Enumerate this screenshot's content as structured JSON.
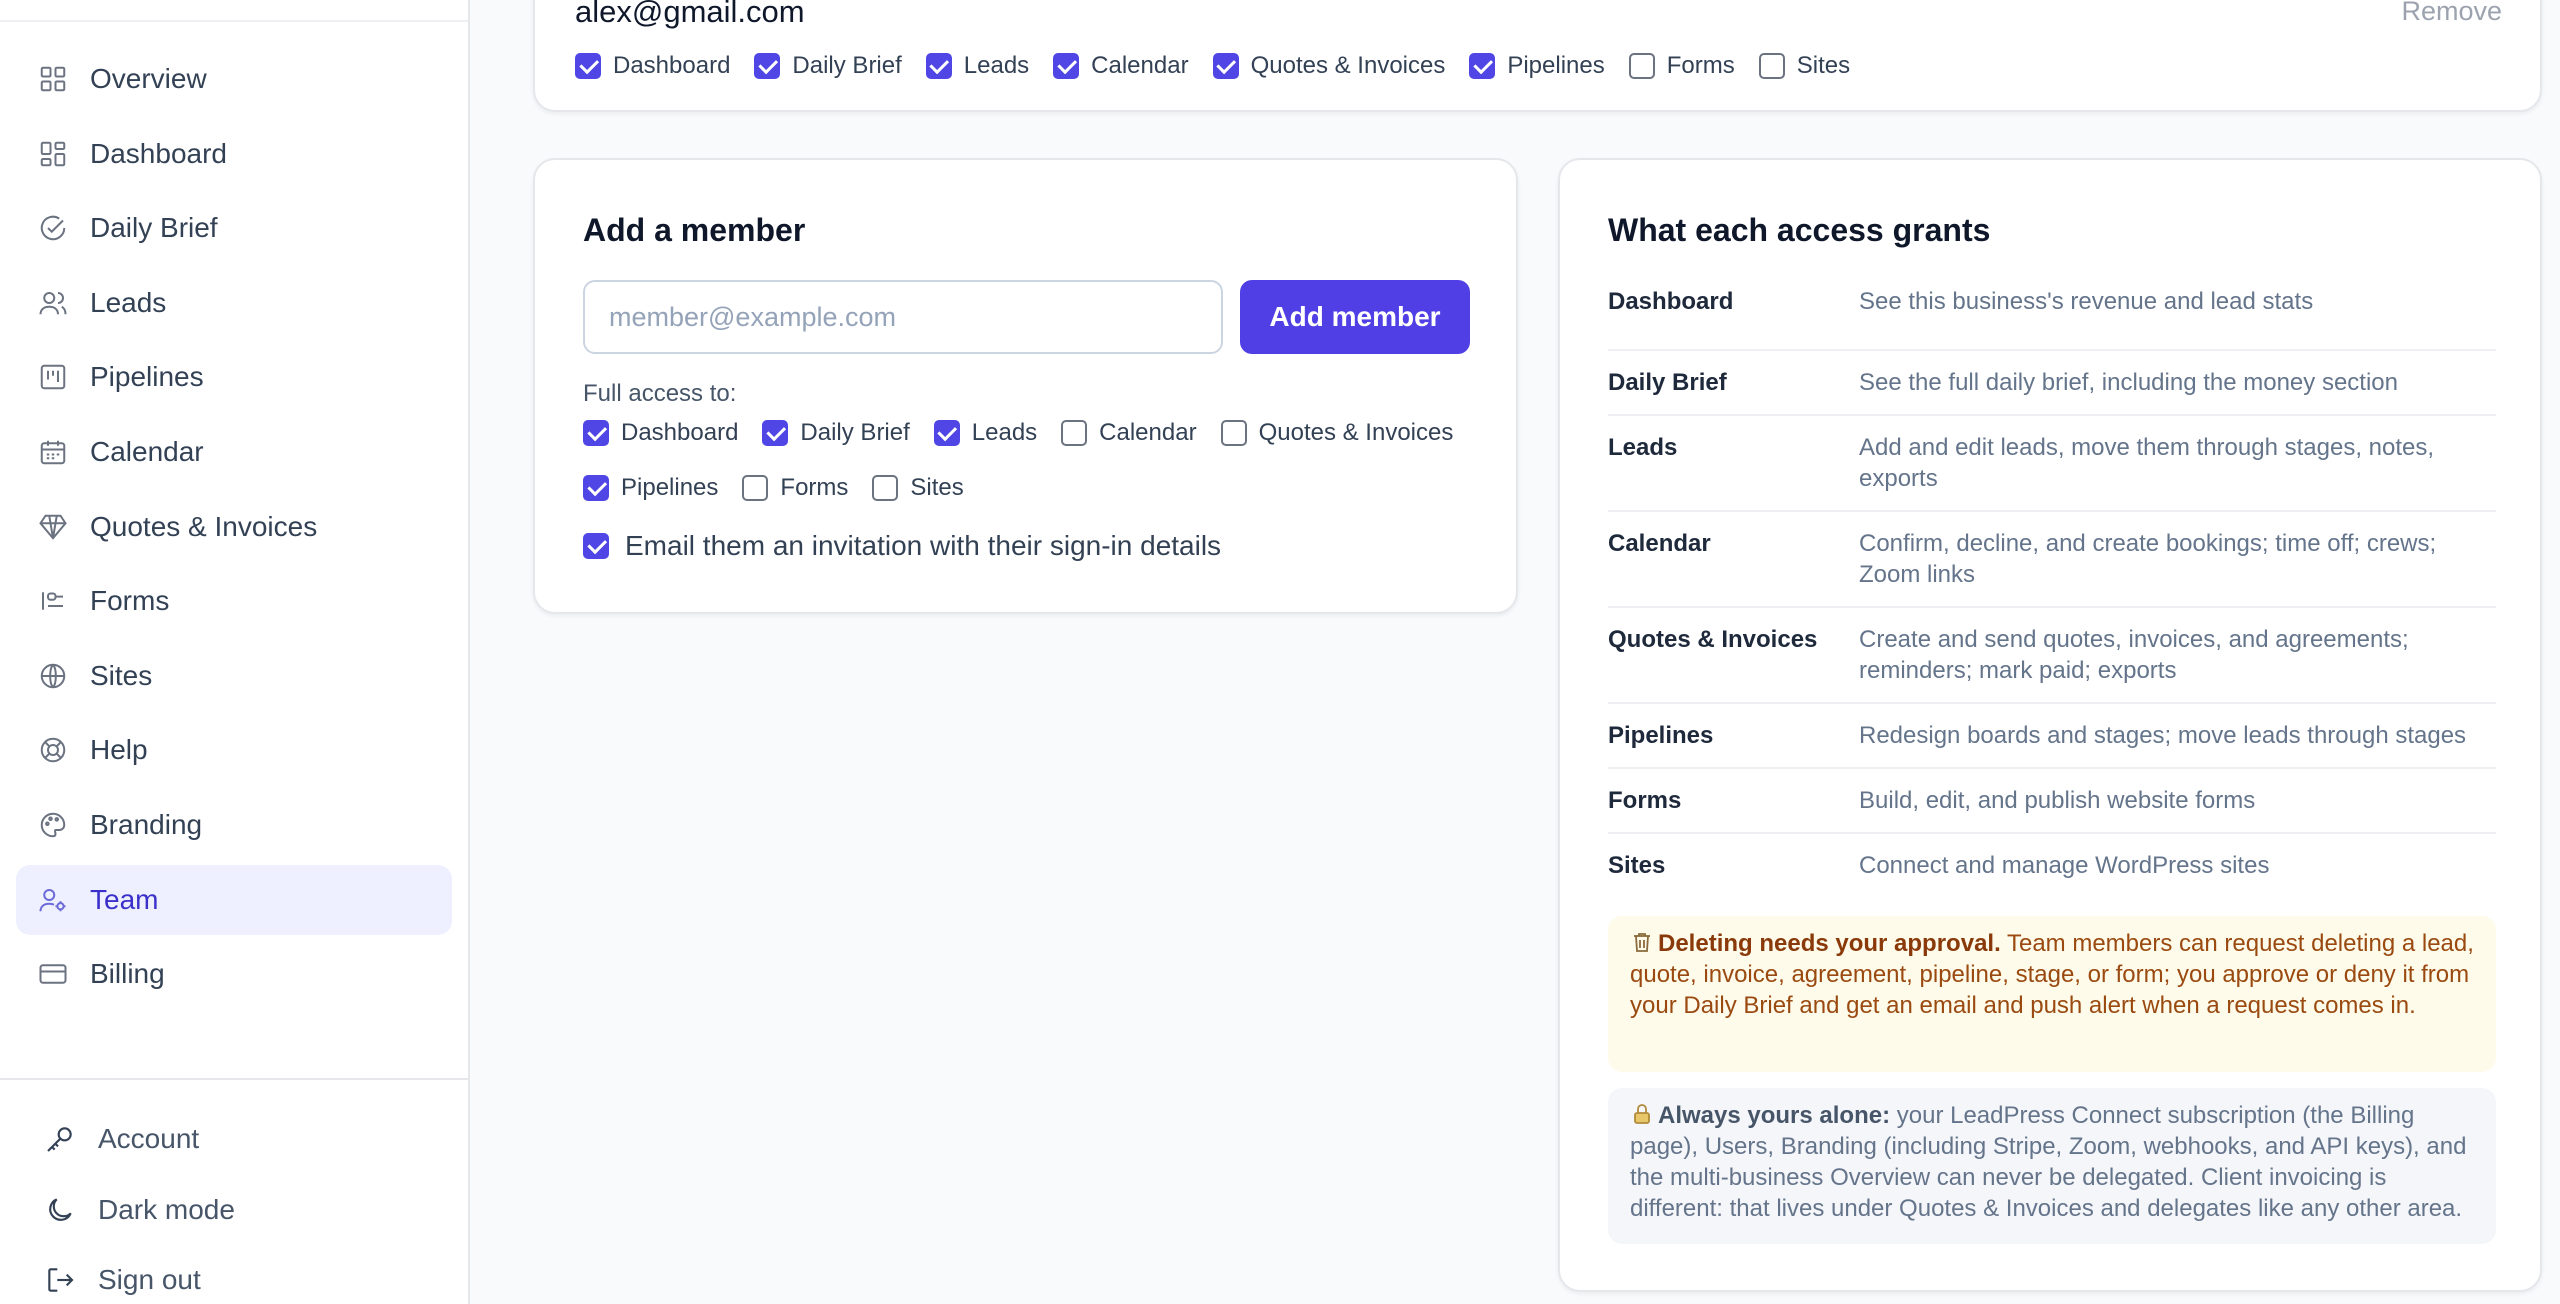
{
  "sidebar": {
    "items": [
      {
        "label": "Overview",
        "icon": "grid-icon"
      },
      {
        "label": "Dashboard",
        "icon": "dashboard-icon"
      },
      {
        "label": "Daily Brief",
        "icon": "check-circle-icon"
      },
      {
        "label": "Leads",
        "icon": "users-icon"
      },
      {
        "label": "Pipelines",
        "icon": "kanban-icon"
      },
      {
        "label": "Calendar",
        "icon": "calendar-icon"
      },
      {
        "label": "Quotes & Invoices",
        "icon": "diamond-icon"
      },
      {
        "label": "Forms",
        "icon": "form-icon"
      },
      {
        "label": "Sites",
        "icon": "globe-icon"
      },
      {
        "label": "Help",
        "icon": "lifebuoy-icon"
      },
      {
        "label": "Branding",
        "icon": "palette-icon"
      },
      {
        "label": "Team",
        "icon": "user-gear-icon",
        "active": true
      },
      {
        "label": "Billing",
        "icon": "credit-card-icon"
      }
    ],
    "bottom": [
      {
        "label": "Account",
        "icon": "key-icon"
      },
      {
        "label": "Dark mode",
        "icon": "moon-icon"
      },
      {
        "label": "Sign out",
        "icon": "sign-out-icon"
      }
    ]
  },
  "existing_member": {
    "email": "alex@gmail.com",
    "remove_label": "Remove",
    "permissions": [
      {
        "label": "Dashboard",
        "checked": true
      },
      {
        "label": "Daily Brief",
        "checked": true
      },
      {
        "label": "Leads",
        "checked": true
      },
      {
        "label": "Calendar",
        "checked": true
      },
      {
        "label": "Quotes & Invoices",
        "checked": true
      },
      {
        "label": "Pipelines",
        "checked": true
      },
      {
        "label": "Forms",
        "checked": false
      },
      {
        "label": "Sites",
        "checked": false
      }
    ]
  },
  "add_member": {
    "title": "Add a member",
    "email_placeholder": "member@example.com",
    "email_value": "",
    "button_label": "Add member",
    "full_access_label": "Full access to:",
    "permissions_row1": [
      {
        "label": "Dashboard",
        "checked": true
      },
      {
        "label": "Daily Brief",
        "checked": true
      },
      {
        "label": "Leads",
        "checked": true
      },
      {
        "label": "Calendar",
        "checked": false
      },
      {
        "label": "Quotes & Invoices",
        "checked": false
      }
    ],
    "permissions_row2": [
      {
        "label": "Pipelines",
        "checked": true
      },
      {
        "label": "Forms",
        "checked": false
      },
      {
        "label": "Sites",
        "checked": false
      }
    ],
    "invite_label": "Email them an invitation with their sign-in details",
    "invite_checked": true
  },
  "grants": {
    "title": "What each access grants",
    "rows": [
      {
        "name": "Dashboard",
        "desc": "See this business's revenue and lead stats"
      },
      {
        "name": "Daily Brief",
        "desc": "See the full daily brief, including the money section"
      },
      {
        "name": "Leads",
        "desc": "Add and edit leads, move them through stages, notes, exports"
      },
      {
        "name": "Calendar",
        "desc": "Confirm, decline, and create bookings; time off; crews; Zoom links"
      },
      {
        "name": "Quotes & Invoices",
        "desc": "Create and send quotes, invoices, and agreements; reminders; mark paid; exports"
      },
      {
        "name": "Pipelines",
        "desc": "Redesign boards and stages; move leads through stages"
      },
      {
        "name": "Forms",
        "desc": "Build, edit, and publish website forms"
      },
      {
        "name": "Sites",
        "desc": "Connect and manage WordPress sites"
      }
    ],
    "warn_bold": "Deleting needs your approval.",
    "warn_text": " Team members can request deleting a lead, quote, invoice, agreement, pipeline, stage, or form; you approve or deny it from your Daily Brief and get an email and push alert when a request comes in.",
    "info_bold": "Always yours alone:",
    "info_text": " your LeadPress Connect subscription (the Billing page), Users, Branding (including Stripe, Zoom, webhooks, and API keys), and the multi-business Overview can never be delegated. Client invoicing is different: that lives under Quotes & Invoices and delegates like any other area."
  },
  "colors": {
    "accent": "#4f46e5",
    "active_bg": "#eef0ff",
    "warn_bg": "#fefbea",
    "warn_text": "#9a4a10"
  }
}
